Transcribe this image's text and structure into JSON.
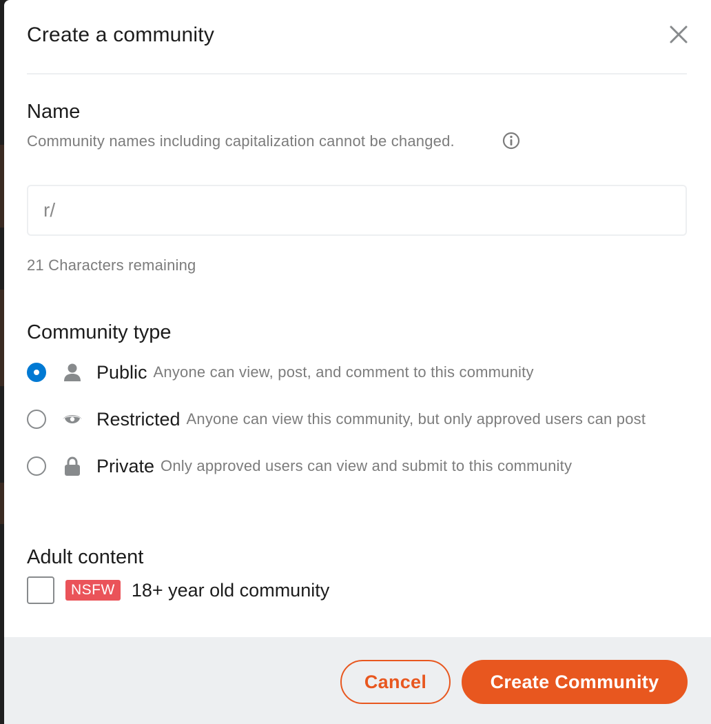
{
  "modal": {
    "title": "Create a community",
    "close_icon": "close-icon"
  },
  "name_section": {
    "label": "Name",
    "help_text": "Community names including capitalization cannot be changed.",
    "info_icon": "info-icon",
    "input_value": "",
    "input_placeholder": "r/",
    "chars_remaining": "21 Characters remaining"
  },
  "community_type": {
    "label": "Community type",
    "options": [
      {
        "label": "Public",
        "description": "Anyone can view, post, and comment to this community",
        "icon": "person-icon",
        "selected": true
      },
      {
        "label": "Restricted",
        "description": "Anyone can view this community, but only approved users can post",
        "icon": "eye-icon",
        "selected": false
      },
      {
        "label": "Private",
        "description": "Only approved users can view and submit to this community",
        "icon": "lock-icon",
        "selected": false
      }
    ]
  },
  "adult_content": {
    "label": "Adult content",
    "badge": "NSFW",
    "checkbox_label": "18+ year old community",
    "checked": false
  },
  "footer": {
    "cancel_label": "Cancel",
    "create_label": "Create Community"
  },
  "colors": {
    "accent": "#e8571f",
    "radio_selected": "#0079d3",
    "nsfw": "#ea5359",
    "footer_bg": "#edeff1"
  }
}
